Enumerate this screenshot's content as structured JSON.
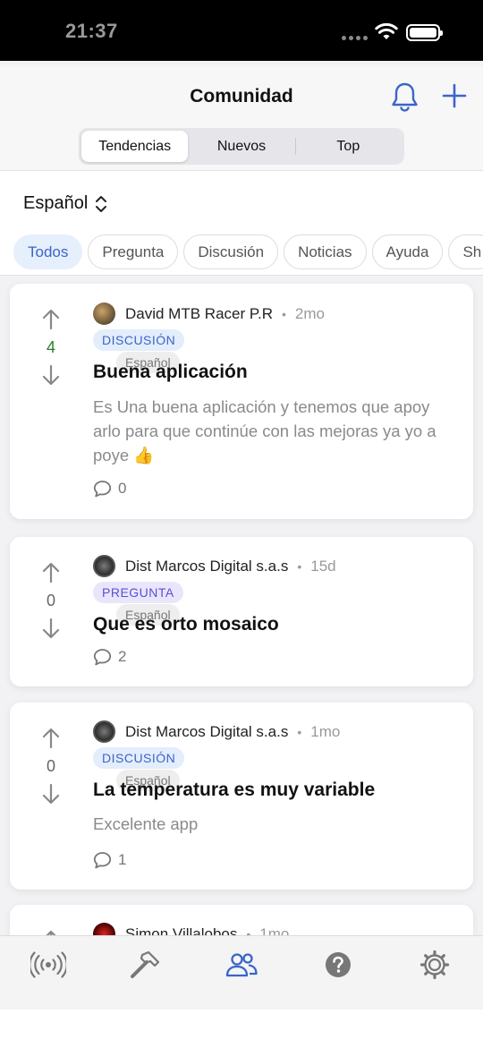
{
  "status_bar": {
    "time": "21:37"
  },
  "header": {
    "title": "Comunidad",
    "segments": [
      "Tendencias",
      "Nuevos",
      "Top"
    ],
    "active_segment": "Tendencias"
  },
  "filters": {
    "language": "Español",
    "chips": [
      "Todos",
      "Pregunta",
      "Discusión",
      "Noticias",
      "Ayuda",
      "Sh"
    ],
    "active_chip": "Todos"
  },
  "posts": [
    {
      "votes": "4",
      "author": "David MTB Racer P.R",
      "time": "2mo",
      "category": "DISCUSIÓN",
      "language": "Español",
      "title": "Buena aplicación",
      "body": "Es Una buena aplicación y tenemos que apoy arlo para que continúe con las mejoras ya yo a poye 👍",
      "comments": "0"
    },
    {
      "votes": "0",
      "author": "Dist Marcos Digital s.a.s",
      "time": "15d",
      "category": "PREGUNTA",
      "language": "Español",
      "title": "Que es orto mosaico",
      "body": "",
      "comments": "2"
    },
    {
      "votes": "0",
      "author": "Dist Marcos Digital s.a.s",
      "time": "1mo",
      "category": "DISCUSIÓN",
      "language": "Español",
      "title": "La temperatura es muy variable",
      "body": "Excelente app",
      "comments": "1"
    },
    {
      "author": "Simon Villalobos",
      "time": "1mo"
    }
  ],
  "tab_bar": {
    "tabs": [
      "broadcast-icon",
      "hammer-icon",
      "community-icon",
      "help-icon",
      "settings-icon"
    ],
    "active_tab": "community-icon",
    "active_color": "#3a65c9"
  }
}
